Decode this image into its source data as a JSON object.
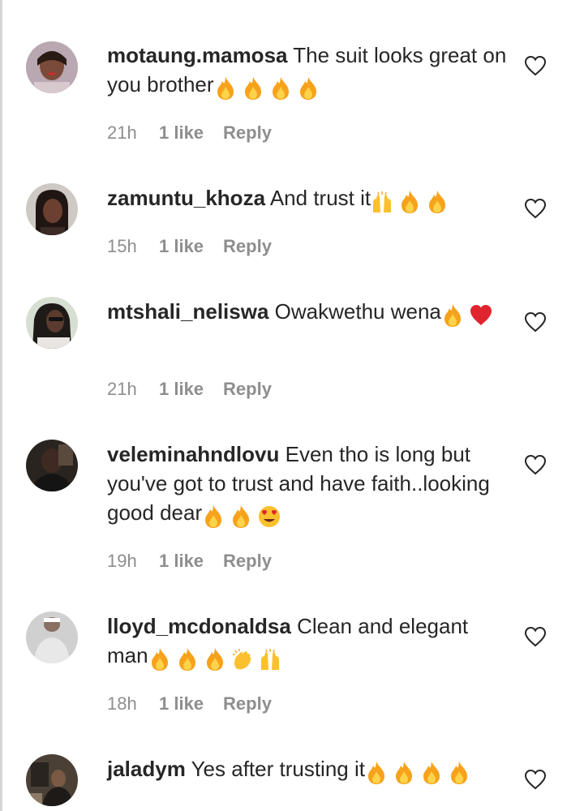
{
  "comments": [
    {
      "username": "motaung.mamosa",
      "text": "The suit looks great on you brother",
      "emojis": [
        "fire",
        "fire",
        "fire",
        "fire"
      ],
      "time": "21h",
      "likes": "1 like",
      "reply": "Reply"
    },
    {
      "username": "zamuntu_khoza",
      "text": "And trust it",
      "emojis": [
        "raising-hands",
        "fire",
        "fire"
      ],
      "time": "15h",
      "likes": "1 like",
      "reply": "Reply"
    },
    {
      "username": "mtshali_neliswa",
      "text": "Owakwethu wena",
      "emojis": [
        "fire",
        "red-heart"
      ],
      "time": "21h",
      "likes": "1 like",
      "reply": "Reply"
    },
    {
      "username": "veleminahndlovu",
      "text": "Even tho is long but you've got to trust and have faith..looking good dear",
      "emojis": [
        "fire",
        "fire",
        "heart-eyes"
      ],
      "time": "19h",
      "likes": "1 like",
      "reply": "Reply"
    },
    {
      "username": "lloyd_mcdonaldsa",
      "text": "Clean and elegant man",
      "emojis": [
        "fire",
        "fire",
        "fire",
        "clapping-hands",
        "raising-hands"
      ],
      "time": "18h",
      "likes": "1 like",
      "reply": "Reply"
    },
    {
      "username": "jaladym",
      "text": "Yes after trusting it",
      "emojis": [
        "fire",
        "fire",
        "fire",
        "fire"
      ],
      "time": "",
      "likes": "",
      "reply": ""
    }
  ],
  "colors": {
    "text": "#262626",
    "meta": "#8e8e8e",
    "fire": "#f7a21b",
    "heart": "#e0242e"
  }
}
